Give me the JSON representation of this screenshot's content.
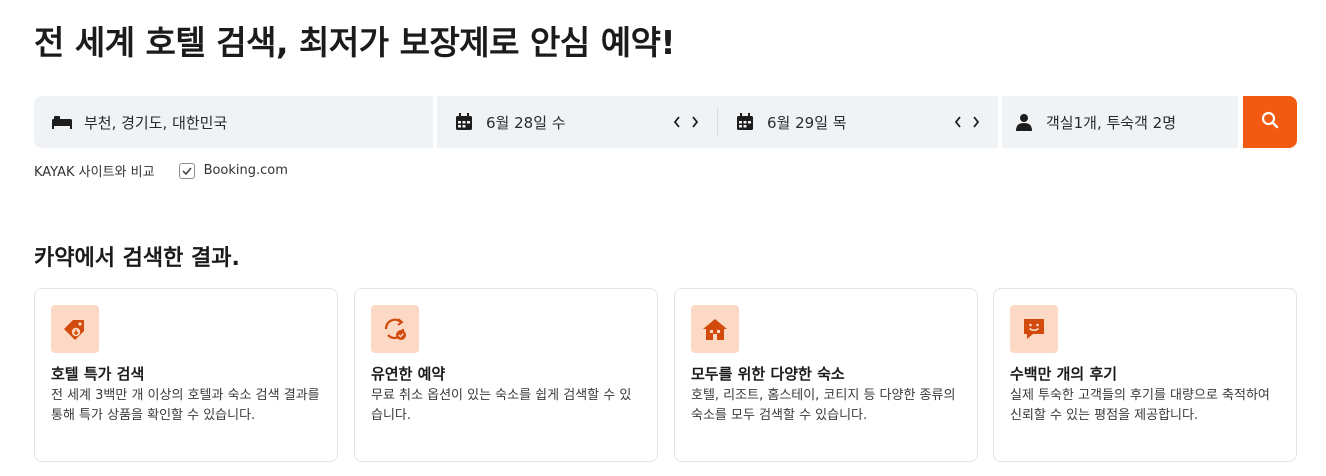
{
  "headline": "전 세계 호텔 검색, 최저가 보장제로 안심 예약!",
  "search": {
    "destination": "부천, 경기도, 대한민국",
    "checkin": "6월 28일 수",
    "checkout": "6월 29일 목",
    "guests": "객실1개, 투숙객 2명",
    "prev_arrow": "‹",
    "next_arrow": "›",
    "accent_color": "#f35a11"
  },
  "compare": {
    "label": "KAYAK 사이트와 비교",
    "provider": "Booking.com",
    "checked": true
  },
  "section_title": "카약에서 검색한 결과.",
  "features": [
    {
      "icon": "price-tag-icon",
      "title": "호텔 특가 검색",
      "desc": "전 세계 3백만 개 이상의 호텔과 숙소 검색 결과를 통해 특가 상품을 확인할 수 있습니다."
    },
    {
      "icon": "flexible-refresh-icon",
      "title": "유연한 예약",
      "desc": "무료 취소 옵션이 있는 숙소를 쉽게 검색할 수 있습니다."
    },
    {
      "icon": "house-icon",
      "title": "모두를 위한 다양한 숙소",
      "desc": "호텔, 리조트, 홈스테이, 코티지 등 다양한 종류의 숙소를 모두 검색할 수 있습니다."
    },
    {
      "icon": "review-smile-icon",
      "title": "수백만 개의 후기",
      "desc": "실제 투숙한 고객들의 후기를 대량으로 축적하여 신뢰할 수 있는 평점을 제공합니다."
    }
  ]
}
